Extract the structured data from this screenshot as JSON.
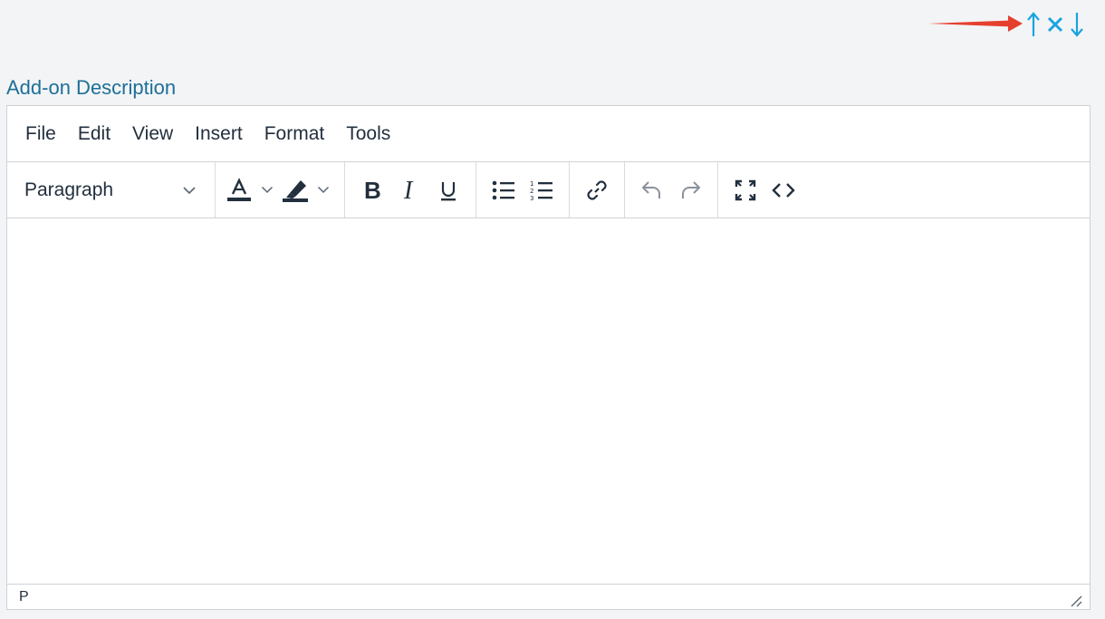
{
  "controls": {
    "move_up_icon": "arrow-up-icon",
    "remove_icon": "close-icon",
    "move_down_icon": "arrow-down-icon",
    "control_color": "#1aa3e0",
    "annotation_color": "#e5402e"
  },
  "field": {
    "label": "Add-on Description",
    "label_color": "#1d6f97"
  },
  "editor": {
    "menu": [
      "File",
      "Edit",
      "View",
      "Insert",
      "Format",
      "Tools"
    ],
    "toolbar": {
      "block_format": "Paragraph",
      "buttons": [
        "text-color-icon",
        "highlight-color-icon",
        "bold-icon",
        "italic-icon",
        "underline-icon",
        "bullet-list-icon",
        "numbered-list-icon",
        "link-icon",
        "undo-icon",
        "redo-icon",
        "fullscreen-icon",
        "source-code-icon"
      ]
    },
    "content": "",
    "status_path": "P"
  }
}
